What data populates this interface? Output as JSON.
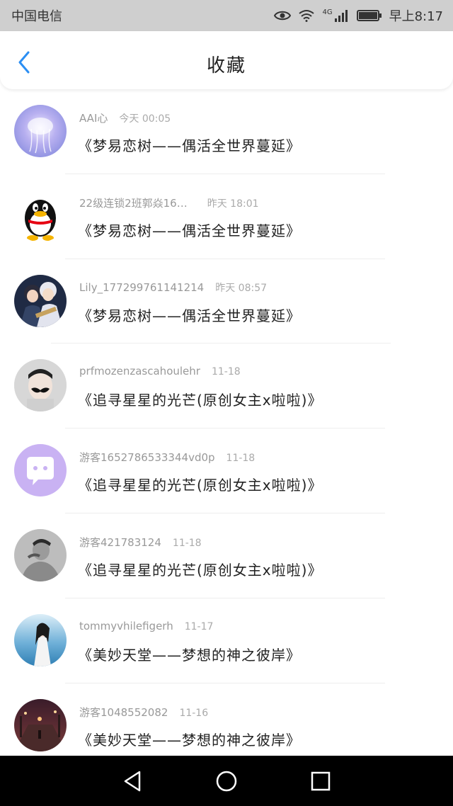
{
  "status_bar": {
    "carrier": "中国电信",
    "network": "4G",
    "time": "早上8:17"
  },
  "header": {
    "title": "收藏",
    "back_icon": "chevron-left-icon",
    "accent_color": "#2b8ef3"
  },
  "items": [
    {
      "user": "AAI心",
      "time": "今天 00:05",
      "title": "《梦易恋树——偶活全世界蔓延》",
      "avatar": "jellyfish-avatar"
    },
    {
      "user": "22级连锁2班郭焱16…",
      "time": "昨天 18:01",
      "title": "《梦易恋树——偶活全世界蔓延》",
      "avatar": "qq-penguin-avatar"
    },
    {
      "user": "Lily_177299761141214",
      "time": "昨天 08:57",
      "title": "《梦易恋树——偶活全世界蔓延》",
      "avatar": "anime-avatar"
    },
    {
      "user": "prfmozenzascahoulehr",
      "time": "11-18",
      "title": "《追寻星星的光芒(原创女主x啦啦)》",
      "avatar": "mustache-avatar"
    },
    {
      "user": "游客1652786533344vd0p",
      "time": "11-18",
      "title": "《追寻星星的光芒(原创女主x啦啦)》",
      "avatar": "chat-bubble-avatar"
    },
    {
      "user": "游客421783124",
      "time": "11-18",
      "title": "《追寻星星的光芒(原创女主x啦啦)》",
      "avatar": "man-photo-avatar"
    },
    {
      "user": "tommyvhilefigerh",
      "time": "11-17",
      "title": "《美妙天堂——梦想的神之彼岸》",
      "avatar": "girl-beach-avatar"
    },
    {
      "user": "游客1048552082",
      "time": "11-16",
      "title": "《美妙天堂——梦想的神之彼岸》",
      "avatar": "night-street-avatar"
    }
  ],
  "bottom_nav": {
    "back": "triangle-back-icon",
    "home": "circle-home-icon",
    "recent": "square-recent-icon"
  }
}
